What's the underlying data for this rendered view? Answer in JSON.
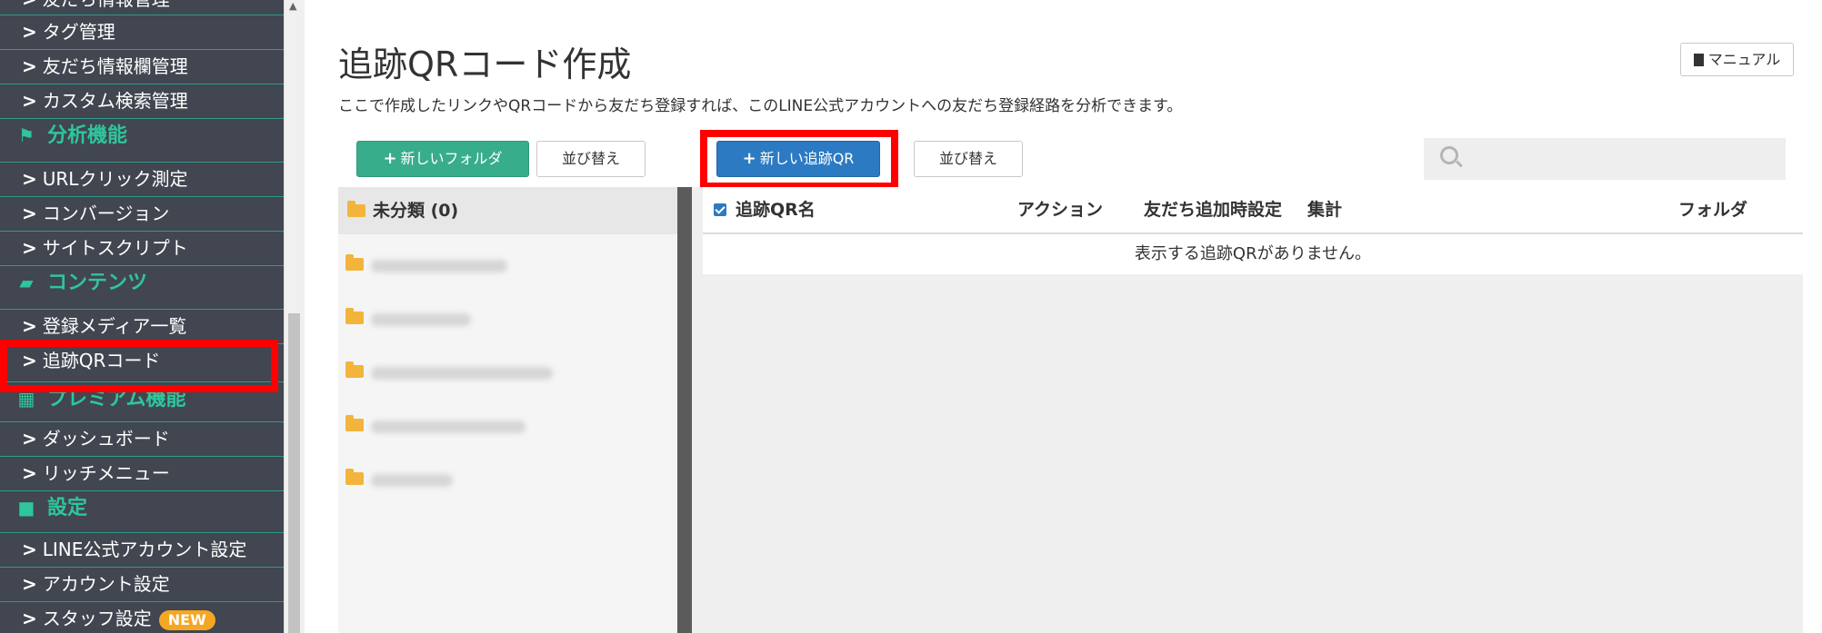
{
  "sidebar": {
    "top_item": "友だち情報管理",
    "items": {
      "tag": "タグ管理",
      "friend_fields": "友だち情報欄管理",
      "custom_search": "カスタム検索管理",
      "analysis": "分析機能",
      "url_click": "URLクリック測定",
      "conversion": "コンバージョン",
      "site_script": "サイトスクリプト",
      "contents": "コンテンツ",
      "media_list": "登録メディア一覧",
      "tracking_qr": "追跡QRコード",
      "premium": "プレミアム機能",
      "dashboard": "ダッシュボード",
      "rich_menu": "リッチメニュー",
      "settings": "設定",
      "line_account": "LINE公式アカウント設定",
      "account": "アカウント設定",
      "staff": "スタッフ設定",
      "new_badge": "NEW"
    }
  },
  "main": {
    "title": "追跡QRコード作成",
    "description": "ここで作成したリンクやQRコードから友だち登録すれば、このLINE公式アカウントへの友だち登録経路を分析できます。",
    "manual_label": "マニュアル",
    "new_folder_label": "新しいフォルダ",
    "sort_label": "並び替え",
    "new_qr_label": "新しい追跡QR",
    "sort_label_2": "並び替え",
    "search_placeholder": ""
  },
  "folders": {
    "uncategorized": "未分類 (0)"
  },
  "table": {
    "columns": {
      "name": "追跡QR名",
      "action": "アクション",
      "friend_add": "友だち追加時設定",
      "summary": "集計",
      "folder": "フォルダ"
    },
    "empty_message": "表示する追跡QRがありません。"
  },
  "colors": {
    "sidebar_bg": "#414650",
    "sidebar_accent": "#2fc59d",
    "primary_blue": "#2c7ac2",
    "green": "#38ad8b",
    "highlight": "#ff0000"
  }
}
